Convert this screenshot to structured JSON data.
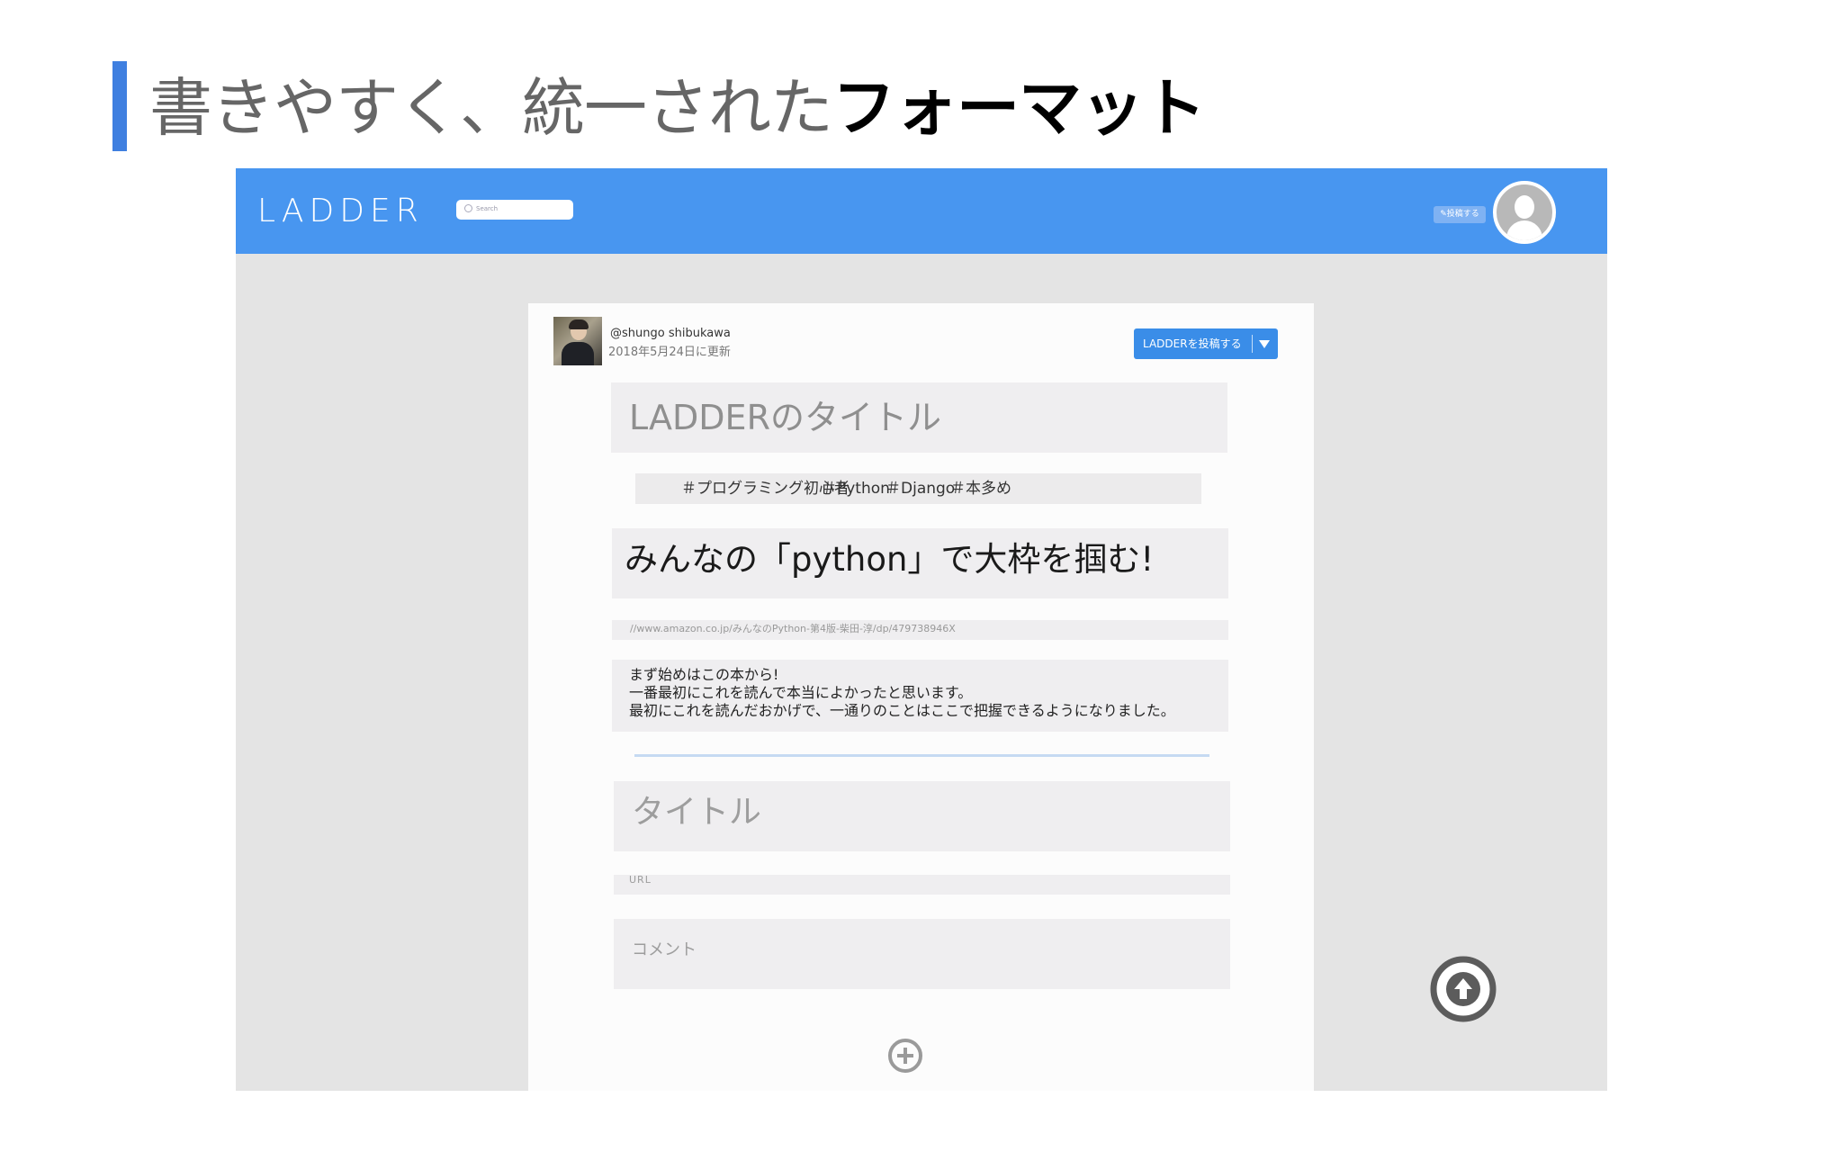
{
  "slide": {
    "title_main": "書きやすく、統一された",
    "title_emphasis": "フォーマット"
  },
  "app": {
    "logo": "LADDER",
    "search_placeholder": "Search",
    "post_button_label": "✎投稿する"
  },
  "post": {
    "username": "@shungo shibukawa",
    "updated": "2018年5月24日に更新",
    "publish_label": "LADDERを投稿する",
    "title_placeholder": "LADDERのタイトル",
    "tags": [
      "＃プログラミング初心者",
      "＃Python",
      "＃Django",
      "＃本多め"
    ],
    "entries": [
      {
        "title": "みんなの「python」で大枠を掴む!",
        "url": "//www.amazon.co.jp/みんなのPython-第4版-柴田-淳/dp/479738946X",
        "comment_lines": [
          "まず始めはこの本から!",
          "一番最初にこれを読んで本当によかったと思います。",
          "最初にこれを読んだおかげで、一通りのことはここで把握できるようになりました。"
        ]
      }
    ],
    "new_entry": {
      "title_placeholder": "タイトル",
      "url_placeholder": "URL",
      "comment_placeholder": "コメント"
    }
  },
  "icons": {
    "add": "plus-circle-icon",
    "scroll_top": "arrow-up-circle-icon",
    "avatar": "user-icon",
    "dropdown": "caret-down-icon",
    "search": "search-icon"
  },
  "colors": {
    "accent_bar": "#3f7fe0",
    "header_blue": "#4896f0",
    "publish_blue": "#3a8de8",
    "background_gray": "#e4e4e4"
  }
}
